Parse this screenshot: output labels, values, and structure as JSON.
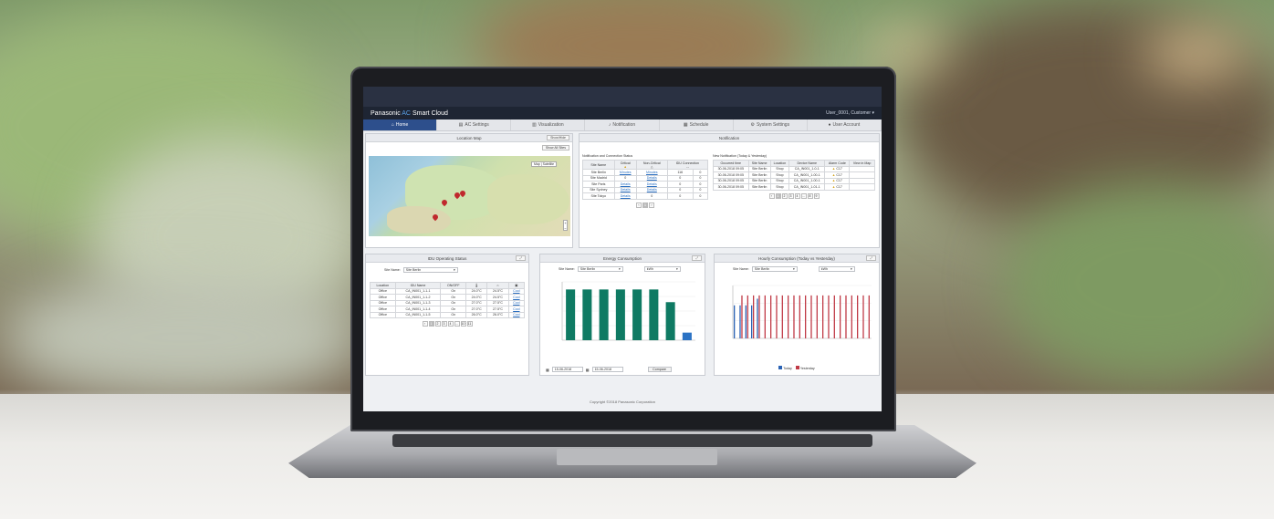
{
  "app": {
    "brand_prefix": "Panasonic",
    "brand_ac": "AC",
    "brand_suffix": "Smart Cloud",
    "user": "User_0001, Customer"
  },
  "nav": [
    {
      "label": "Home",
      "icon": "home-icon",
      "active": true
    },
    {
      "label": "AC Settings",
      "icon": "ac-settings-icon",
      "active": false
    },
    {
      "label": "Visualization",
      "icon": "chart-icon",
      "active": false
    },
    {
      "label": "Notification",
      "icon": "bell-icon",
      "active": false
    },
    {
      "label": "Schedule",
      "icon": "calendar-icon",
      "active": false
    },
    {
      "label": "System Settings",
      "icon": "gear-icon",
      "active": false
    },
    {
      "label": "User Account",
      "icon": "user-icon",
      "active": false
    }
  ],
  "location_map": {
    "title": "Location Map",
    "btn1": "Show/Hide",
    "btn2": "Show All Sites",
    "map_toggle": [
      "Map",
      "Satellite"
    ]
  },
  "notification": {
    "title": "Notification",
    "left_subtitle": "Notification and Connection Status",
    "left_headers": [
      "Site Name",
      "Critical",
      "Non-Critical",
      "IDU Connection"
    ],
    "left_rows": [
      [
        "Site Berlin",
        "Minutes",
        "Minutes",
        "116",
        "0"
      ],
      [
        "Site Madrid",
        "0",
        "Details",
        "0",
        "0"
      ],
      [
        "Site Paris",
        "Details",
        "Details",
        "0",
        "0"
      ],
      [
        "Site Sydney",
        "Details",
        "Details",
        "0",
        "0"
      ],
      [
        "Site Tokyo",
        "Details",
        "0",
        "0",
        "0"
      ]
    ],
    "right_subtitle": "New Notification (Today & Yesterday)",
    "right_headers": [
      "Occurred time",
      "Site Name",
      "Location",
      "Device Name",
      "Alarm Code",
      "View in Map"
    ],
    "right_rows": [
      [
        "30-06-2018 09:05",
        "Site Berlin",
        "Shop",
        "CA_IN001_1-0-1",
        "C17"
      ],
      [
        "30-06-2018 09:05",
        "Site Berlin",
        "Shop",
        "CA_IN001_1-00-1",
        "C17"
      ],
      [
        "30-06-2018 09:05",
        "Site Berlin",
        "Shop",
        "CA_IN001_1-00-1",
        "C17"
      ],
      [
        "30-06-2018 09:05",
        "Site Berlin",
        "Shop",
        "CA_IN001_1-01-1",
        "C17"
      ]
    ],
    "left_pages": [
      "1"
    ],
    "right_pages": [
      "1",
      "2",
      "3",
      "4",
      "...",
      "8",
      "9"
    ]
  },
  "idu": {
    "title": "IDU Operating Status",
    "site_label": "Site Name:",
    "site_value": "Site Berlin",
    "headers": [
      "Location",
      "IDU Name",
      "ON/OFF"
    ],
    "rows": [
      [
        "Office",
        "CA_IN001_1-1-1",
        "On",
        "24.0°C",
        "24.5°C",
        "Cool"
      ],
      [
        "Office",
        "CA_IN001_1-1-2",
        "On",
        "24.0°C",
        "24.5°C",
        "Cool"
      ],
      [
        "Office",
        "CA_IN001_1-1-3",
        "On",
        "27.0°C",
        "27.5°C",
        "Cool"
      ],
      [
        "Office",
        "CA_IN001_1-1-4",
        "On",
        "27.0°C",
        "27.5°C",
        "Cool"
      ],
      [
        "Office",
        "CA_IN001_1-1-5",
        "On",
        "26.0°C",
        "26.0°C",
        "Cool"
      ]
    ],
    "pages": [
      "1",
      "2",
      "3",
      "4",
      "...",
      "10",
      "11"
    ]
  },
  "energy": {
    "title": "Energy Consumption",
    "site_label": "Site Name:",
    "site_value": "Site Berlin",
    "unit_value": "kWh",
    "date_from": "15-06-2018",
    "date_to": "15-06-2018",
    "compare_label": "Compare",
    "color_main": "#0f7a63",
    "color_current": "#2a72c4"
  },
  "hourly": {
    "title": "Hourly Consumption (Today vs Yesterday)",
    "site_label": "Site Name:",
    "site_value": "Site Berlin",
    "unit_value": "kWh",
    "legend_today": "Today",
    "legend_yesterday": "Yesterday",
    "color_today": "#2a62b5",
    "color_yesterday": "#c03a46"
  },
  "chart_data": [
    {
      "type": "bar",
      "values": [
        1,
        1,
        1,
        1,
        1,
        1,
        0.75,
        0.15
      ],
      "ylim": [
        0,
        1.15
      ]
    },
    {
      "type": "bar",
      "series": [
        {
          "name": "Today",
          "values": [
            1,
            1,
            1,
            1,
            1.2,
            0,
            0,
            0,
            0,
            0,
            0,
            0,
            0,
            0,
            0,
            0,
            0,
            0,
            0,
            0,
            0,
            0,
            0,
            0
          ]
        },
        {
          "name": "Yesterday",
          "values": [
            0,
            1.3,
            1.3,
            1.3,
            1.3,
            1.3,
            1.3,
            1.3,
            1.3,
            1.3,
            1.3,
            1.3,
            1.3,
            1.3,
            1.3,
            1.3,
            1.3,
            1.3,
            1.3,
            1.3,
            1.3,
            1.3,
            1.3,
            1.3
          ]
        }
      ],
      "ylim": [
        0,
        1.6
      ]
    }
  ],
  "footer": "Copyright ©2018 Panasonic Corporation"
}
